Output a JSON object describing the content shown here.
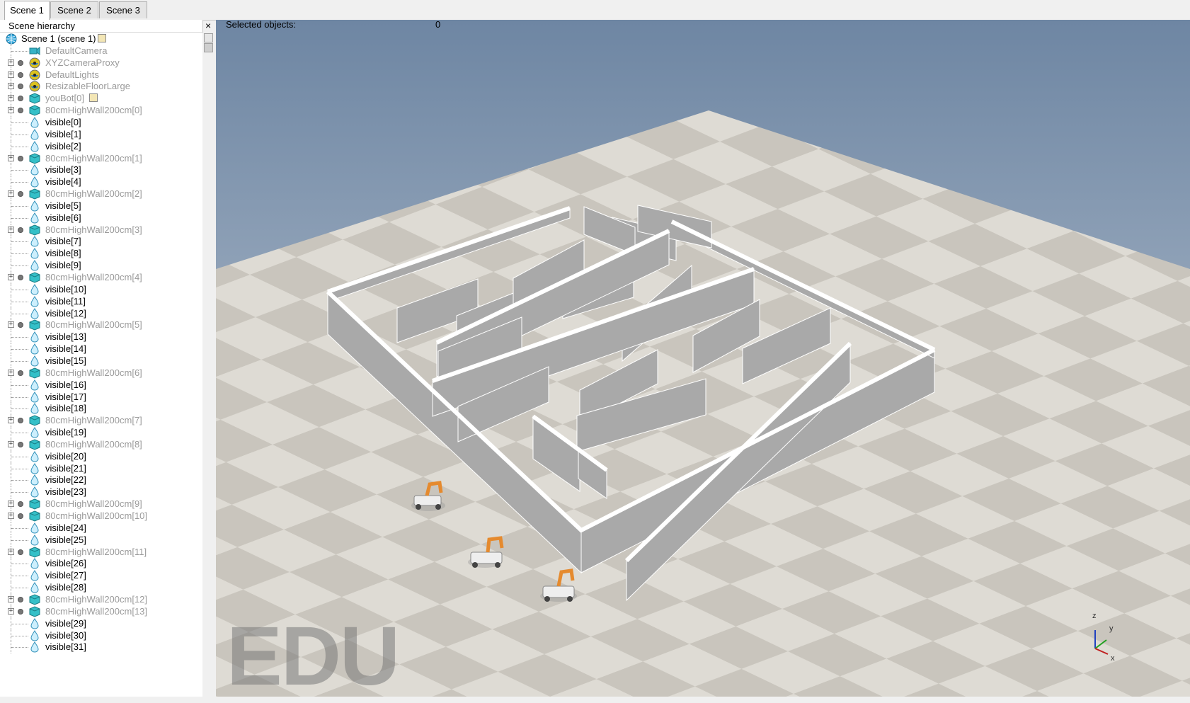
{
  "tabs": [
    {
      "label": "Scene 1"
    },
    {
      "label": "Scene 2"
    },
    {
      "label": "Scene 3"
    }
  ],
  "hierarchy": {
    "title": "Scene hierarchy",
    "close_glyph": "×",
    "rows": [
      {
        "label": "Scene 1 (scene 1)",
        "type": "scene",
        "indent": 0
      },
      {
        "label": "DefaultCamera",
        "type": "camera",
        "indent": 1,
        "expand": false
      },
      {
        "label": "XYZCameraProxy",
        "type": "dummy",
        "indent": 1,
        "expand": true
      },
      {
        "label": "DefaultLights",
        "type": "dummy",
        "indent": 1,
        "expand": true
      },
      {
        "label": "ResizableFloorLarge",
        "type": "dummy",
        "indent": 1,
        "expand": true
      },
      {
        "label": "youBot[0]",
        "type": "shape",
        "indent": 1,
        "expand": true,
        "script": true
      },
      {
        "label": "80cmHighWall200cm[0]",
        "type": "shape",
        "indent": 1,
        "expand": true
      },
      {
        "label": "visible[0]",
        "type": "vis"
      },
      {
        "label": "visible[1]",
        "type": "vis"
      },
      {
        "label": "visible[2]",
        "type": "vis"
      },
      {
        "label": "80cmHighWall200cm[1]",
        "type": "shape",
        "indent": 1,
        "expand": true
      },
      {
        "label": "visible[3]",
        "type": "vis"
      },
      {
        "label": "visible[4]",
        "type": "vis"
      },
      {
        "label": "80cmHighWall200cm[2]",
        "type": "shape",
        "indent": 1,
        "expand": true
      },
      {
        "label": "visible[5]",
        "type": "vis"
      },
      {
        "label": "visible[6]",
        "type": "vis"
      },
      {
        "label": "80cmHighWall200cm[3]",
        "type": "shape",
        "indent": 1,
        "expand": true
      },
      {
        "label": "visible[7]",
        "type": "vis"
      },
      {
        "label": "visible[8]",
        "type": "vis"
      },
      {
        "label": "visible[9]",
        "type": "vis"
      },
      {
        "label": "80cmHighWall200cm[4]",
        "type": "shape",
        "indent": 1,
        "expand": true
      },
      {
        "label": "visible[10]",
        "type": "vis"
      },
      {
        "label": "visible[11]",
        "type": "vis"
      },
      {
        "label": "visible[12]",
        "type": "vis"
      },
      {
        "label": "80cmHighWall200cm[5]",
        "type": "shape",
        "indent": 1,
        "expand": true
      },
      {
        "label": "visible[13]",
        "type": "vis"
      },
      {
        "label": "visible[14]",
        "type": "vis"
      },
      {
        "label": "visible[15]",
        "type": "vis"
      },
      {
        "label": "80cmHighWall200cm[6]",
        "type": "shape",
        "indent": 1,
        "expand": true
      },
      {
        "label": "visible[16]",
        "type": "vis"
      },
      {
        "label": "visible[17]",
        "type": "vis"
      },
      {
        "label": "visible[18]",
        "type": "vis"
      },
      {
        "label": "80cmHighWall200cm[7]",
        "type": "shape",
        "indent": 1,
        "expand": true
      },
      {
        "label": "visible[19]",
        "type": "vis"
      },
      {
        "label": "80cmHighWall200cm[8]",
        "type": "shape",
        "indent": 1,
        "expand": true
      },
      {
        "label": "visible[20]",
        "type": "vis"
      },
      {
        "label": "visible[21]",
        "type": "vis"
      },
      {
        "label": "visible[22]",
        "type": "vis"
      },
      {
        "label": "visible[23]",
        "type": "vis"
      },
      {
        "label": "80cmHighWall200cm[9]",
        "type": "shape",
        "indent": 1,
        "expand": true
      },
      {
        "label": "80cmHighWall200cm[10]",
        "type": "shape",
        "indent": 1,
        "expand": true
      },
      {
        "label": "visible[24]",
        "type": "vis"
      },
      {
        "label": "visible[25]",
        "type": "vis"
      },
      {
        "label": "80cmHighWall200cm[11]",
        "type": "shape",
        "indent": 1,
        "expand": true
      },
      {
        "label": "visible[26]",
        "type": "vis"
      },
      {
        "label": "visible[27]",
        "type": "vis"
      },
      {
        "label": "visible[28]",
        "type": "vis"
      },
      {
        "label": "80cmHighWall200cm[12]",
        "type": "shape",
        "indent": 1,
        "expand": true
      },
      {
        "label": "80cmHighWall200cm[13]",
        "type": "shape",
        "indent": 1,
        "expand": true
      },
      {
        "label": "visible[29]",
        "type": "vis"
      },
      {
        "label": "visible[30]",
        "type": "vis"
      },
      {
        "label": "visible[31]",
        "type": "vis"
      }
    ]
  },
  "viewport": {
    "selected_label": "Selected objects:",
    "selected_count": "0",
    "watermark": "EDU",
    "axes": {
      "z": "z",
      "y": "y",
      "x": "x"
    }
  },
  "colors": {
    "sky_top": "#6e86a3",
    "sky_bottom": "#c6cfd9",
    "floor_light": "#dedbd4",
    "floor_dark": "#c7c3bb",
    "wall_side": "#a9a9a9",
    "wall_top": "#ffffff",
    "robot_orange": "#e58a2e"
  }
}
